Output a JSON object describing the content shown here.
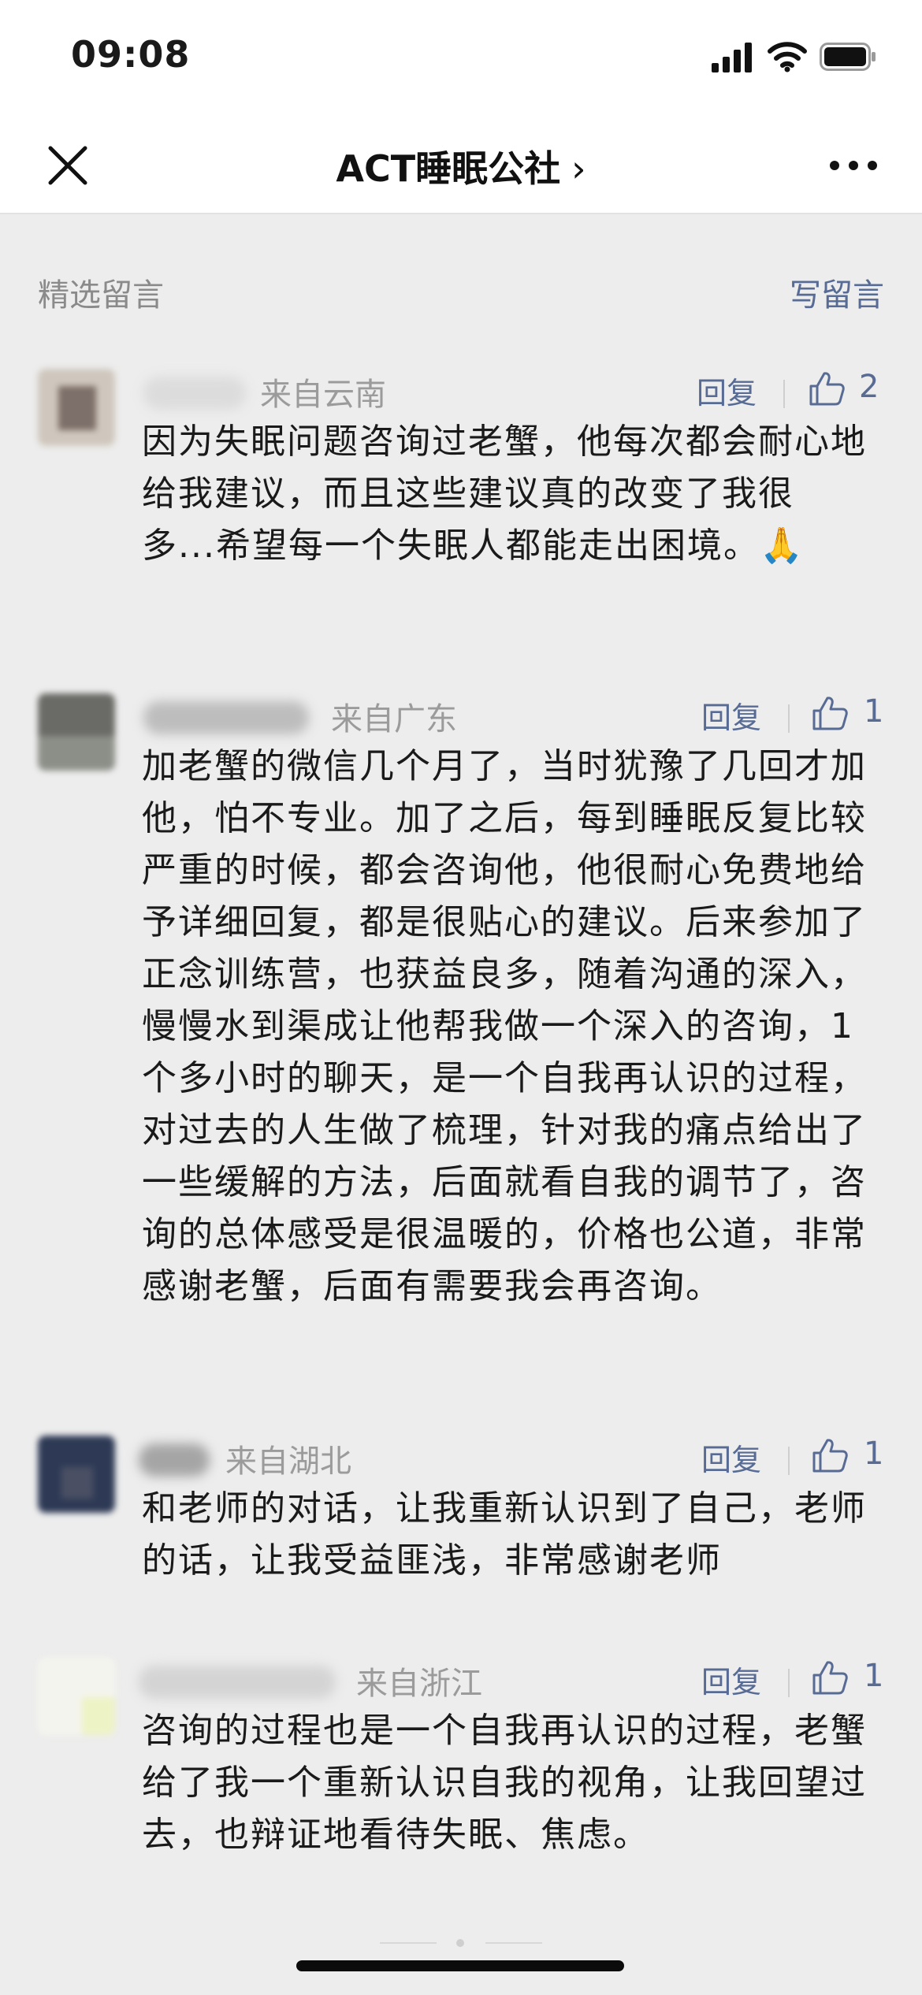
{
  "status_bar": {
    "time": "09:08"
  },
  "nav": {
    "title": "ACT睡眠公社",
    "chevron": "›"
  },
  "section": {
    "title": "精选留言",
    "write_label": "写留言"
  },
  "comments": [
    {
      "location": "来自云南",
      "reply_label": "回复",
      "likes": "2",
      "text": "因为失眠问题咨询过老蟹，他每次都会耐心地给我建议，而且这些建议真的改变了我很多...希望每一个失眠人都能走出困境。🙏"
    },
    {
      "location": "来自广东",
      "reply_label": "回复",
      "likes": "1",
      "text": "加老蟹的微信几个月了，当时犹豫了几回才加他，怕不专业。加了之后，每到睡眠反复比较严重的时候，都会咨询他，他很耐心免费地给予详细回复，都是很贴心的建议。后来参加了正念训练营，也获益良多，随着沟通的深入，慢慢水到渠成让他帮我做一个深入的咨询，1个多小时的聊天，是一个自我再认识的过程，对过去的人生做了梳理，针对我的痛点给出了一些缓解的方法，后面就看自我的调节了，咨询的总体感受是很温暖的，价格也公道，非常感谢老蟹，后面有需要我会再咨询。"
    },
    {
      "location": "来自湖北",
      "reply_label": "回复",
      "likes": "1",
      "text": "和老师的对话，让我重新认识到了自己，老师的话，让我受益匪浅，非常感谢老师"
    },
    {
      "location": "来自浙江",
      "reply_label": "回复",
      "likes": "1",
      "text": "咨询的过程也是一个自我再认识的过程，老蟹给了我一个重新认识自我的视角，让我回望过去，也辩证地看待失眠、焦虑。"
    }
  ],
  "icons": {
    "close": "close-icon",
    "more": "more-icon",
    "like": "thumbs-up-icon",
    "signal": "signal-icon",
    "wifi": "wifi-icon",
    "battery": "battery-icon"
  },
  "colors": {
    "link": "#576b95",
    "muted": "#8a8a8a",
    "background": "#ededed"
  }
}
